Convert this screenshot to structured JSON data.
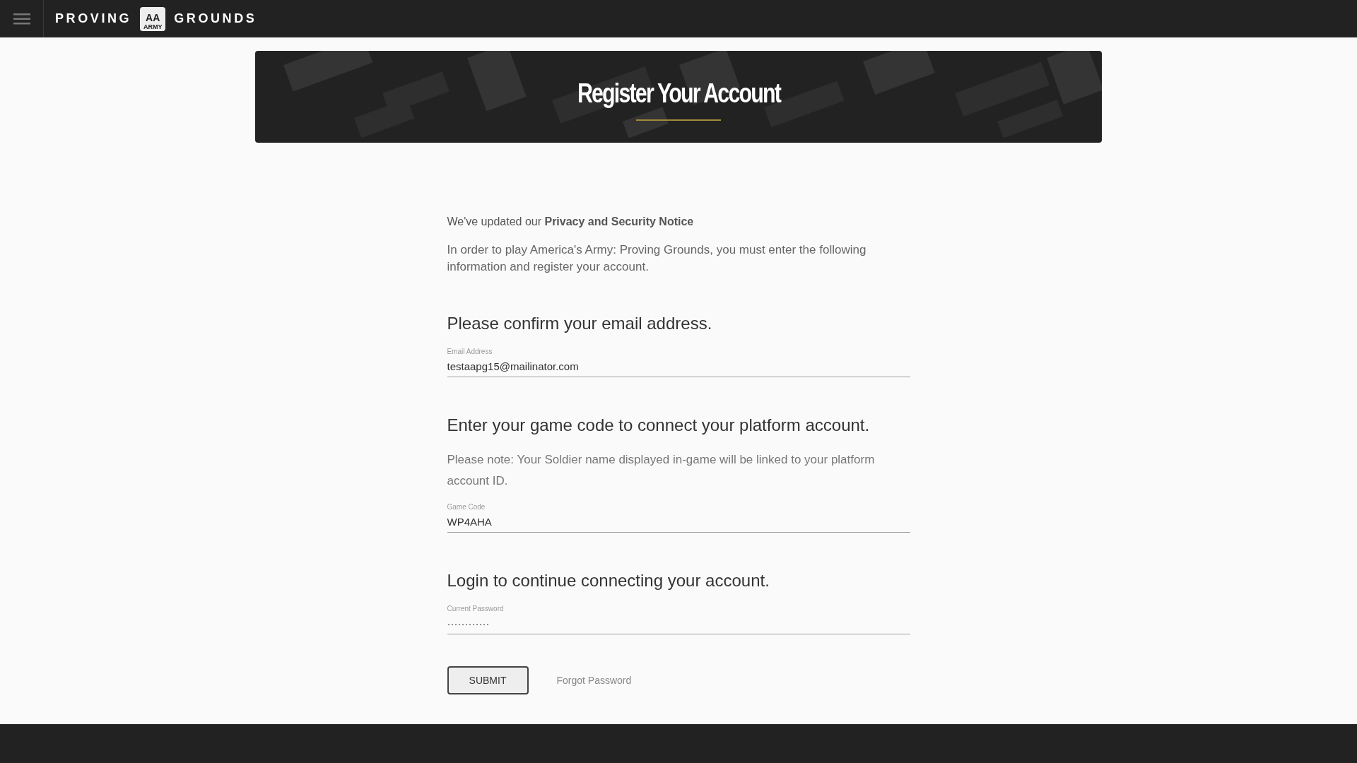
{
  "top_bar": {
    "logo": {
      "left_word": "PROVING",
      "badge_letters": "AA",
      "badge_caption": "ARMY",
      "right_word": "GROUNDS"
    }
  },
  "banner": {
    "title": "Register Your Account"
  },
  "notice": {
    "text": "We've updated our **Privacy and Security Notice**"
  },
  "intro": "In order to play America's Army: Proving Grounds, you must enter the following information and register your account.",
  "sections": [
    {
      "heading": "Please confirm your email address.",
      "fields": [
        {
          "label": "Email Address",
          "value": "testaapg15@mailinator.com"
        }
      ]
    },
    {
      "heading": "Enter your game code to connect your platform account.",
      "note": "Please note: Your Soldier name displayed in-game will be linked to your platform account ID.",
      "fields": [
        {
          "label": "Game Code",
          "value": "WP4AHA"
        }
      ]
    },
    {
      "heading": "Login to continue connecting your account.",
      "fields": [
        {
          "label": "Current Password",
          "value": "············"
        }
      ]
    }
  ],
  "actions": {
    "submit": "SUBMIT",
    "forgot": "Forgot Password"
  }
}
